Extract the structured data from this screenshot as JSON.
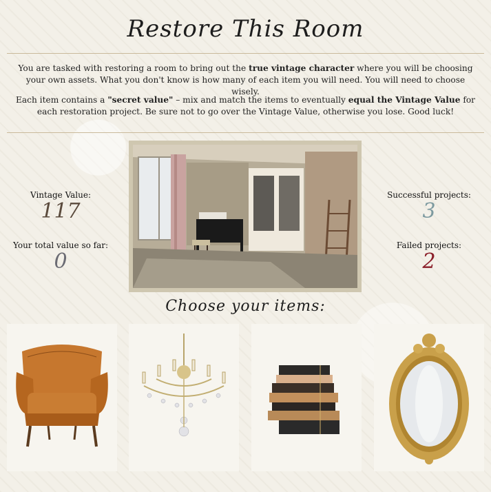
{
  "header": {
    "title": "Restore This Room"
  },
  "intro": {
    "p1_a": "You are tasked with restoring a room to bring out the ",
    "p1_b": "true vintage character",
    "p1_c": " where you will be choosing your own assets. What you don't know is how many of each item you will need. You will need to choose wisely.",
    "p2_a": "Each item contains a ",
    "p2_b": "\"secret value\"",
    "p2_c": " – mix and match the items to eventually ",
    "p2_d": "equal the Vintage Value",
    "p2_e": " for each restoration project. Be sure not to go over the Vintage Value, otherwise you lose. Good luck!"
  },
  "stats": {
    "vintage_label": "Vintage Value:",
    "vintage_value": "117",
    "total_label": "Your total value so far:",
    "total_value": "0",
    "success_label": "Successful projects:",
    "success_value": "3",
    "failed_label": "Failed projects:",
    "failed_value": "2"
  },
  "colors": {
    "vintage": "#5a4a3c",
    "total": "#6b6b73",
    "success": "#7d9aa0",
    "failed": "#8b1f2a"
  },
  "main": {
    "room_image": "abandoned-room-with-piano",
    "choose_label": "Choose your items:"
  },
  "items": [
    {
      "name": "leather-armchair",
      "icon": "armchair-icon"
    },
    {
      "name": "crystal-chandelier",
      "icon": "chandelier-icon"
    },
    {
      "name": "stack-of-books",
      "icon": "books-icon"
    },
    {
      "name": "ornate-mirror",
      "icon": "mirror-icon"
    }
  ]
}
